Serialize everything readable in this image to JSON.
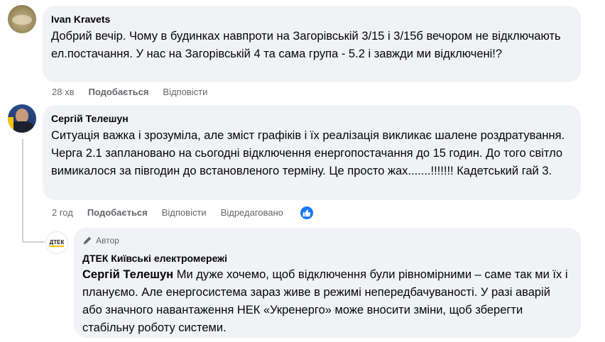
{
  "comments": [
    {
      "author": "Ivan Kravets",
      "text": "Добрий вечір. Чому в будинках навпроти на Загорівській 3/15 і 3/15б вечором не відключають ел.постачання. У нас на Загорівській 4 та сама група - 5.2 і завжди ми відключені!?",
      "time": "28 хв",
      "like_label": "Подобається",
      "reply_label": "Відповісти"
    },
    {
      "author": "Сергій Телешун",
      "text": "Ситуація важка і зрозуміла, але зміст графіків і їх реалізація викликає шалене роздратування. Черга 2.1 заплановано на сьогодні відключення енергопостачання до 15 годин. До того світло вимикалося за півгодин до встановленого терміну. Це просто жах.......!!!!!!! Кадетський гай 3.",
      "time": "2 год",
      "like_label": "Подобається",
      "reply_label": "Відповісти",
      "edited_label": "Відредаговано"
    }
  ],
  "reply": {
    "author_badge": "Автор",
    "author": "ДТЕК Київські електромережі",
    "avatar_text": "ДТЕК",
    "mention": "Сергій Телешун",
    "text": " Ми дуже хочемо, щоб відключення були рівномірними – саме так ми їх і плануємо. Але енергосистема зараз живе в режимі непередбачуваності. У разі аварій або значного навантаження НЕК «Укренерго» може вносити зміни, щоб зберегти стабільну роботу системи."
  },
  "colors": {
    "bubble": "#f0f2f5",
    "meta_text": "#65676b",
    "like_blue": "#1877f2",
    "dtek_yellow": "#f5c400"
  }
}
